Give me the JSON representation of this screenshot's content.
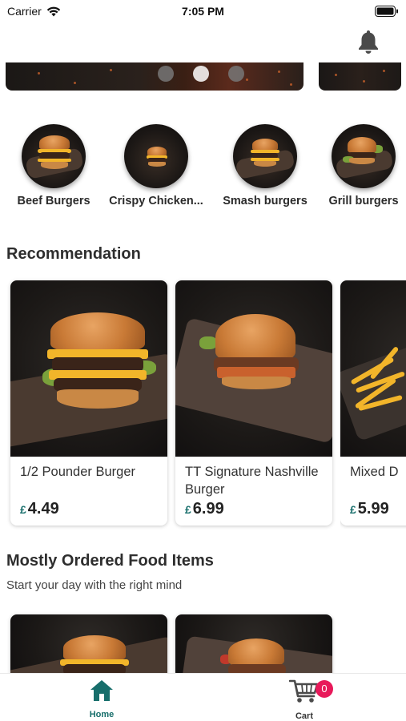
{
  "status_bar": {
    "carrier": "Carrier",
    "time": "7:05 PM"
  },
  "banner": {
    "slide_count": 3,
    "active_slide": 2
  },
  "categories": [
    {
      "label": "Beef Burgers"
    },
    {
      "label": "Crispy Chicken..."
    },
    {
      "label": "Smash burgers"
    },
    {
      "label": "Grill burgers"
    }
  ],
  "recommendation": {
    "title": "Recommendation",
    "items": [
      {
        "name": "1/2 Pounder Burger",
        "currency": "£",
        "price": "4.49"
      },
      {
        "name": "TT Signature Nashville Burger",
        "currency": "£",
        "price": "6.99"
      },
      {
        "name": "Mixed D",
        "currency": "£",
        "price": "5.99"
      }
    ]
  },
  "mostly_ordered": {
    "title": "Mostly Ordered Food Items",
    "subtitle": "Start your day with the right mind"
  },
  "tabbar": {
    "home_label": "Home",
    "cart_label": "Cart",
    "cart_count": "0",
    "active_color": "#176e6b",
    "badge_color": "#e8195a"
  },
  "icons": [
    "wifi-icon",
    "battery-icon",
    "bell-icon",
    "home-icon",
    "cart-icon"
  ]
}
